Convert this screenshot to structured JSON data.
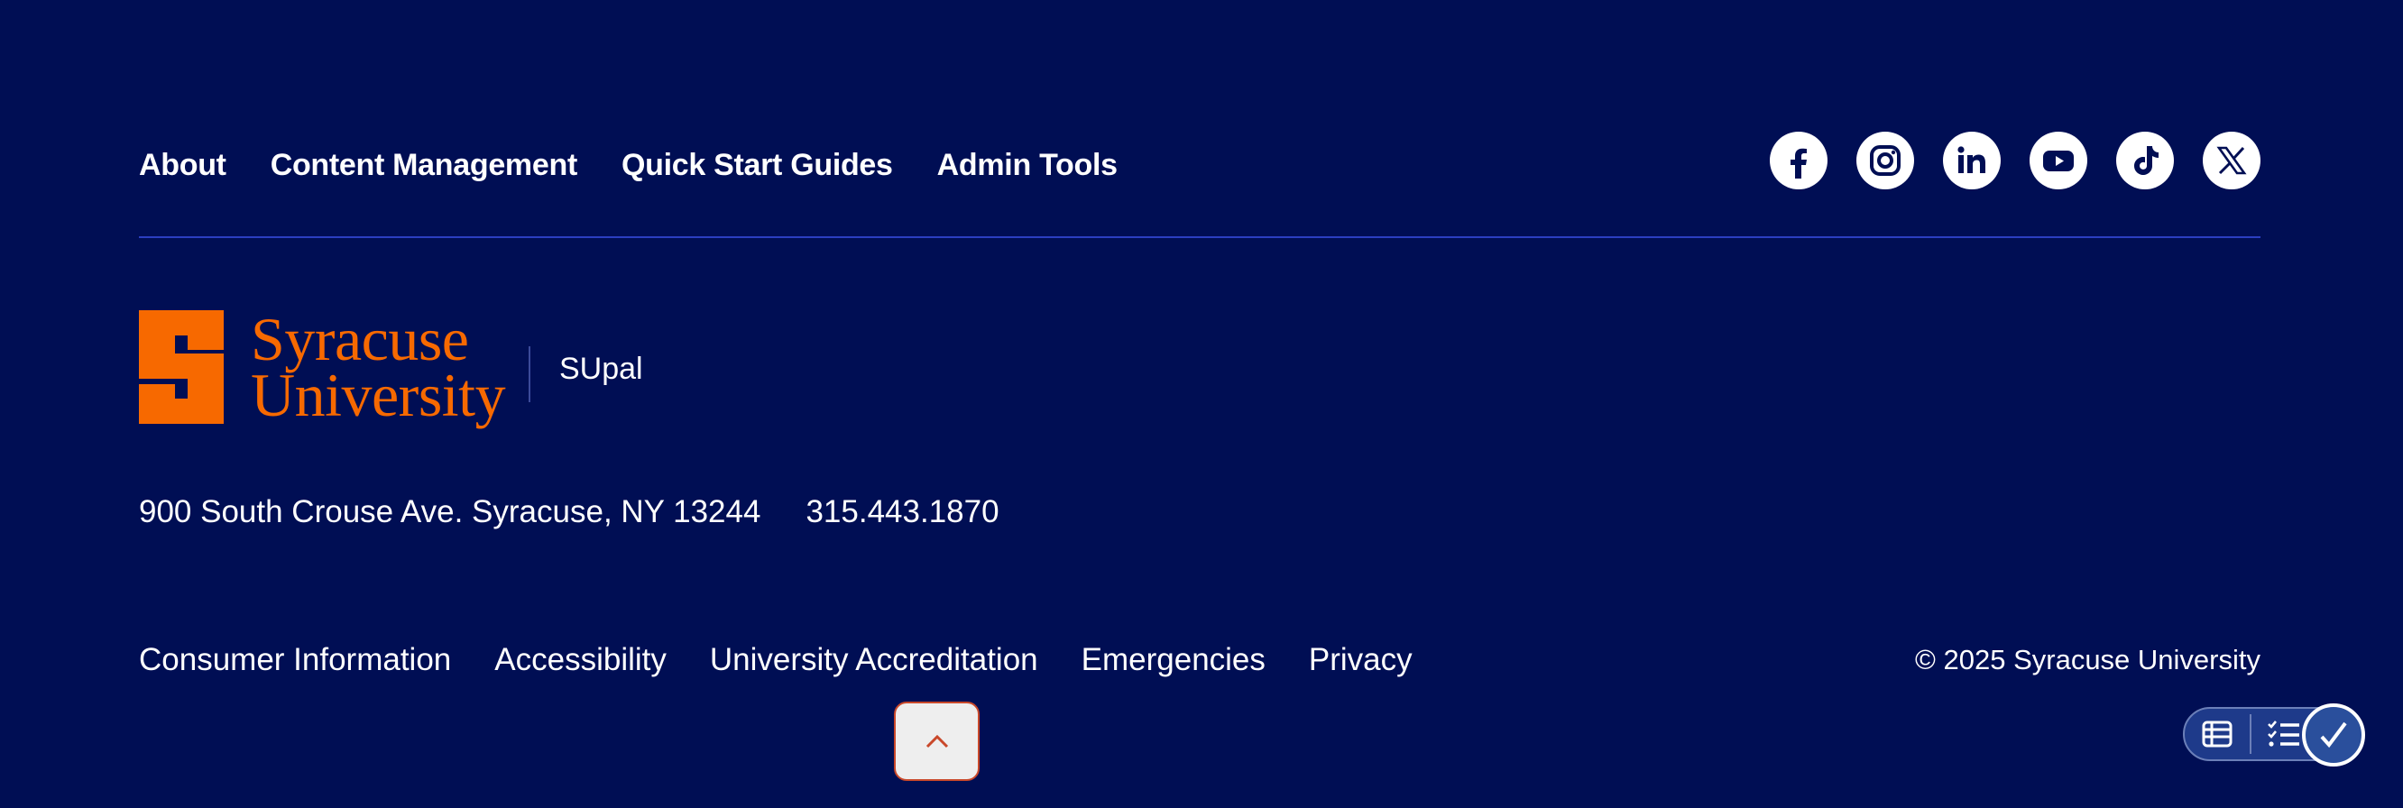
{
  "top_nav": {
    "items": [
      "About",
      "Content Management",
      "Quick Start Guides",
      "Admin Tools"
    ]
  },
  "social": {
    "icons": [
      "facebook-icon",
      "instagram-icon",
      "linkedin-icon",
      "youtube-icon",
      "tiktok-icon",
      "x-icon"
    ]
  },
  "brand": {
    "wordmark_line1": "Syracuse",
    "wordmark_line2": "University",
    "site_name": "SUpal",
    "accent_color": "#f76900",
    "background_color": "#000e54"
  },
  "contact": {
    "address": "900 South Crouse Ave. Syracuse, NY 13244",
    "phone": "315.443.1870"
  },
  "bottom_nav": {
    "items": [
      "Consumer Information",
      "Accessibility",
      "University Accreditation",
      "Emergencies",
      "Privacy"
    ]
  },
  "copyright": "© 2025 Syracuse University",
  "widgets": {
    "back_to_top_icon": "chevron-up-icon",
    "a11y_icons": [
      "table-icon",
      "checklist-icon",
      "checkmark-icon"
    ]
  }
}
